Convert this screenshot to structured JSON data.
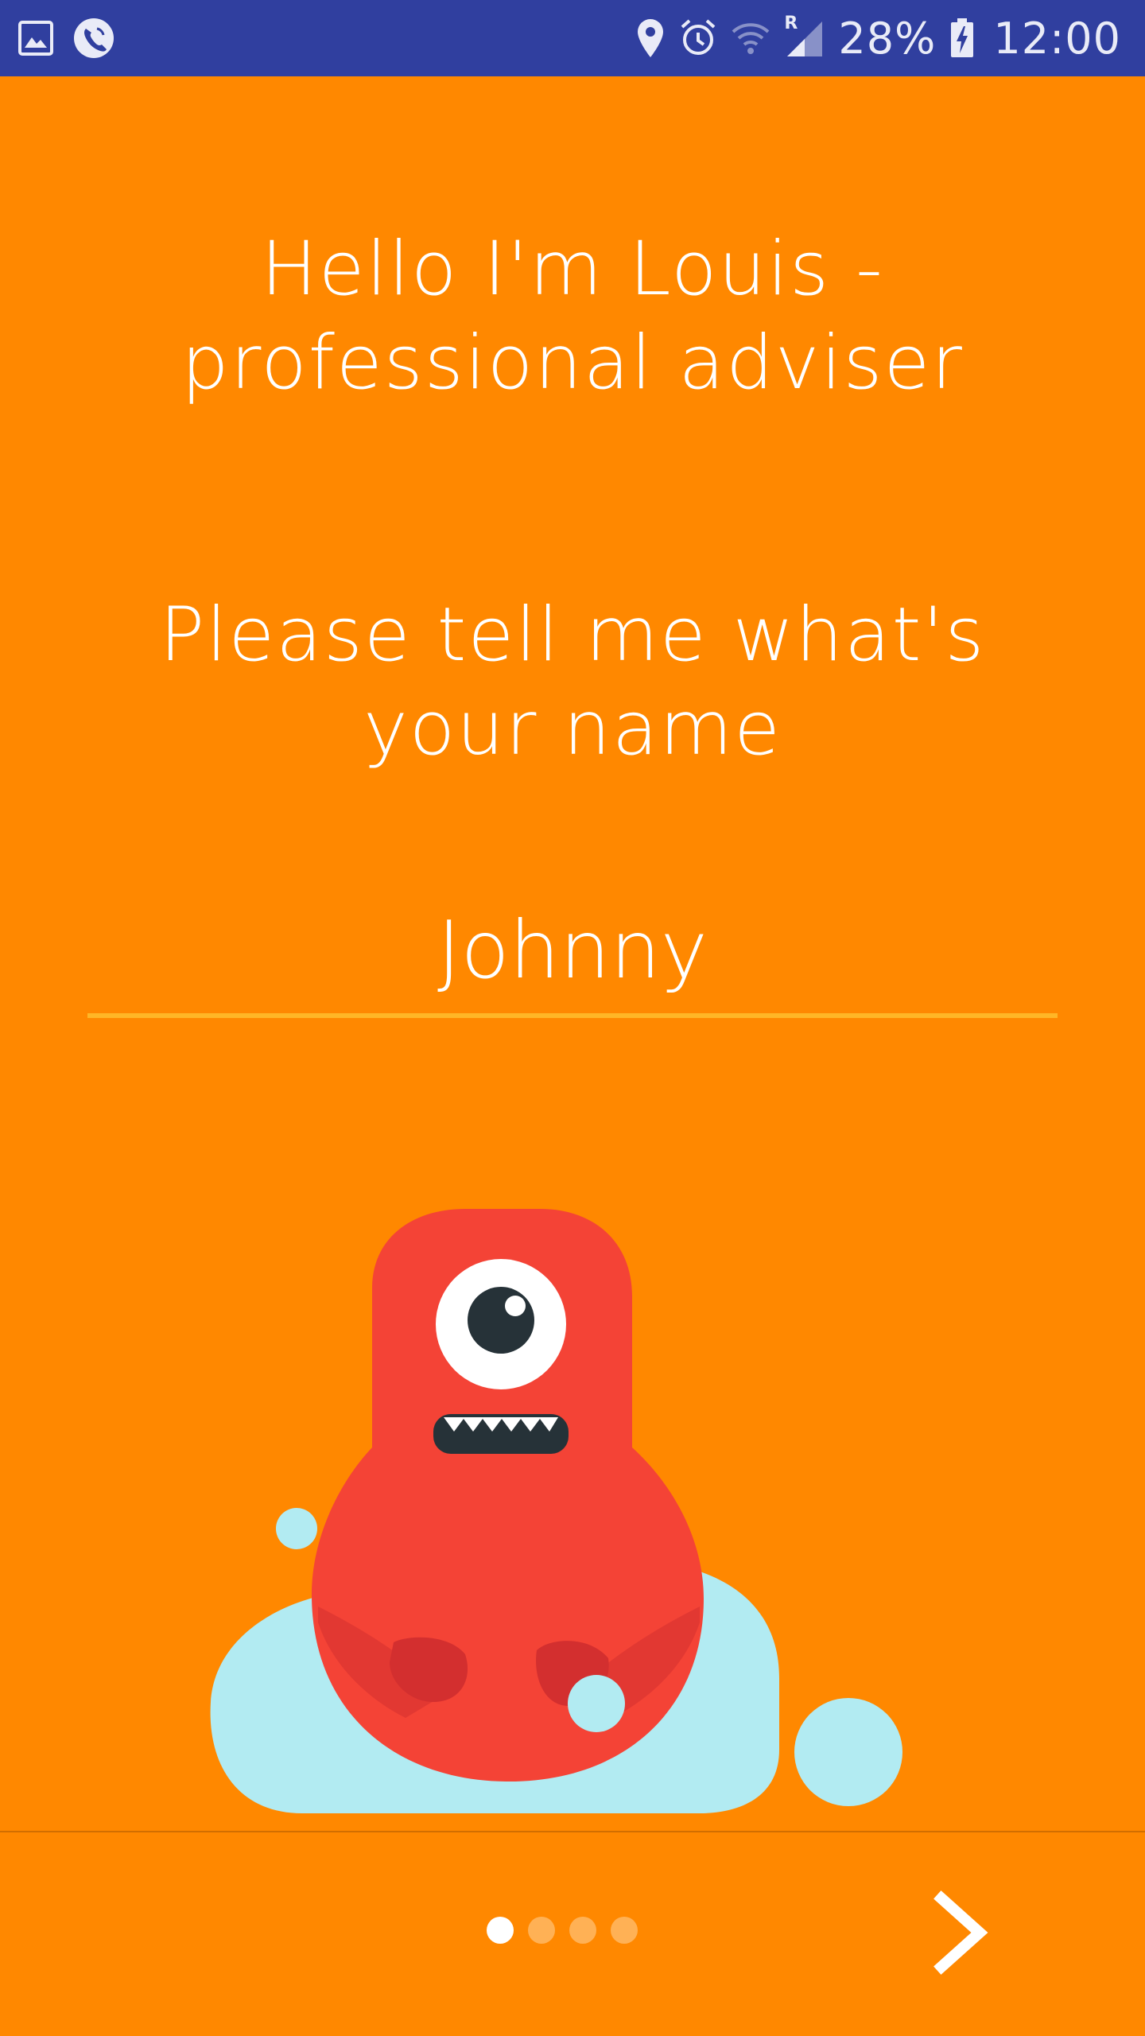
{
  "status_bar": {
    "icons": [
      "image-icon",
      "phone-call-icon",
      "location-icon",
      "alarm-icon",
      "wifi-icon",
      "signal-icon",
      "battery-charging-icon"
    ],
    "battery_percent": "28%",
    "time": "12:00",
    "roaming": "R"
  },
  "greeting": {
    "line1": "Hello I'm Louis -",
    "line2": "professional adviser"
  },
  "prompt": {
    "line1": "Please tell me what's",
    "line2": "your name"
  },
  "name_field": {
    "value": "Johnny"
  },
  "pager": {
    "total_pages": 4,
    "current_page": 1
  },
  "colors": {
    "background": "#FF8800",
    "status_bar": "#303F9F",
    "underline": "#FFB626",
    "monster": "#F44336",
    "cloud": "#B2EBF2"
  },
  "navigation": {
    "next_icon": "chevron-right-icon"
  }
}
